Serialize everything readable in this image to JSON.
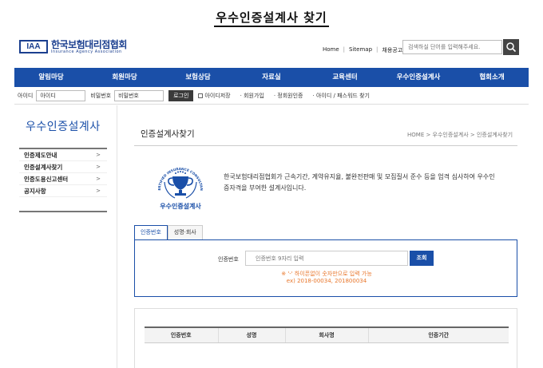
{
  "page_heading": "우수인증설계사 찾기",
  "header": {
    "logo_abbr": "IAA",
    "logo_name": "한국보험대리점협회",
    "logo_sub": "Insurance Agency Association",
    "util_links": [
      "Home",
      "Sitemap",
      "채용공고"
    ],
    "search_placeholder": "검색하실 단어를 입력해주세요."
  },
  "gnb": [
    "알림마당",
    "회원마당",
    "보험상담",
    "자료실",
    "교육센터",
    "우수인증설계사",
    "협회소개"
  ],
  "loginbar": {
    "id_label": "아이디",
    "id_value": "아이디",
    "pw_label": "비밀번호",
    "pw_value": "비밀번호",
    "login_button": "로그인",
    "save_id": "아이디저장",
    "links": [
      "· 회원가입",
      "· 정회원인증",
      "· 아이디 / 패스워드 찾기"
    ]
  },
  "sidebar": {
    "title": "우수인증설계사",
    "items": [
      {
        "label": "인증제도안내"
      },
      {
        "label": "인증설계사찾기"
      },
      {
        "label": "인증도용신고센터"
      },
      {
        "label": "공지사항"
      }
    ]
  },
  "main": {
    "title": "인증설계사찾기",
    "breadcrumb": "HOME > 우수인증설계사 > 인증설계사찾기",
    "badge_arc": "CERTIFIED INSURANCE CONSULTANT",
    "badge_caption": "우수인증설계사",
    "description": "한국보험대리점협회가 근속기간, 계약유지율, 불완전판매 및 모집질서 준수 등을 엄격 심사하여 우수인증자격을 부여한 설계사입니다."
  },
  "tabs": [
    "인증번호",
    "성명·회사"
  ],
  "search": {
    "label": "인증번호",
    "placeholder": "인증번호 9자리 입력",
    "button": "조회",
    "notice_line1": "※ '-' 하이픈없이 숫자만으로 입력 가능",
    "notice_line2": "ex) 2018-00034, 201800034"
  },
  "table": {
    "headers": [
      "인증번호",
      "성명",
      "회사명",
      "인증기간"
    ]
  },
  "colors": {
    "brand": "#1a4fa8",
    "notice": "#e8762b"
  }
}
